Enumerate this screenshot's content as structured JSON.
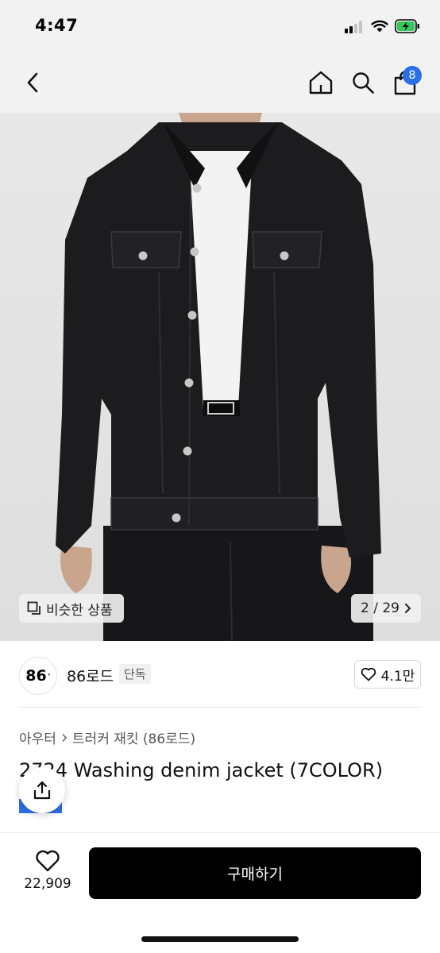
{
  "status_bar": {
    "time": "4:47",
    "icons": [
      "signal-icon",
      "wifi-icon",
      "battery-charging-icon"
    ]
  },
  "nav": {
    "icons": [
      "back-chevron-icon",
      "home-icon",
      "search-icon",
      "shopping-bag-icon"
    ],
    "cart_count": "8"
  },
  "image": {
    "similar_label": "비슷한 상품",
    "counter": "2 / 29",
    "similar_icon": "similar-items-icon",
    "counter_icon": "chevron-right-icon"
  },
  "brand": {
    "logo_text": "86",
    "logo_mark": "°",
    "name": "86로드",
    "badge": "단독",
    "likes": "4.1만",
    "like_icon": "heart-outline-icon"
  },
  "product": {
    "category": "아우터",
    "subcategory": "트러커 재킷 (86로드)",
    "title": "2724 Washing denim jacket (7COLOR)",
    "share_icon": "share-icon"
  },
  "bottom_bar": {
    "wish_count": "22,909",
    "wish_icon": "heart-outline-icon",
    "buy_label": "구매하기"
  },
  "colors": {
    "accent": "#2b6fe8",
    "buy_button": "#000000",
    "jacket": "#1c1c1e",
    "background": "#f2f2f2"
  }
}
